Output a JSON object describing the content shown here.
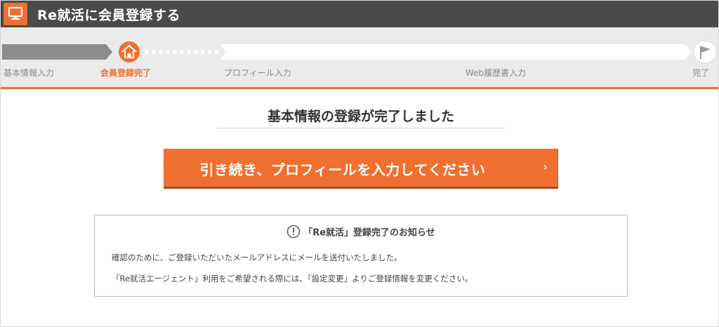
{
  "header": {
    "title": "Re就活に会員登録する",
    "icon": "monitor-icon",
    "accent": "#ef7030"
  },
  "steps": [
    {
      "label": "基本情報入力",
      "state": "done"
    },
    {
      "label": "会員登録完了",
      "state": "current",
      "icon": "home-icon"
    },
    {
      "label": "プロフィール入力",
      "state": "todo"
    },
    {
      "label": "Web履歴書入力",
      "state": "todo"
    },
    {
      "label": "完了",
      "state": "todo",
      "icon": "flag-icon"
    }
  ],
  "main": {
    "title": "基本情報の登録が完了しました",
    "cta_label": "引き続き、プロフィールを入力してください",
    "cta_arrow": "›"
  },
  "notice": {
    "icon": "exclamation-circle-icon",
    "heading": "「Re就活」登録完了のお知らせ",
    "line1": "確認のために、ご登録いただいたメールアドレスにメールを送付いたしました。",
    "line2": "「Re就活エージェント」利用をご希望される際には、「設定変更」よりご登録情報を変更ください。"
  }
}
